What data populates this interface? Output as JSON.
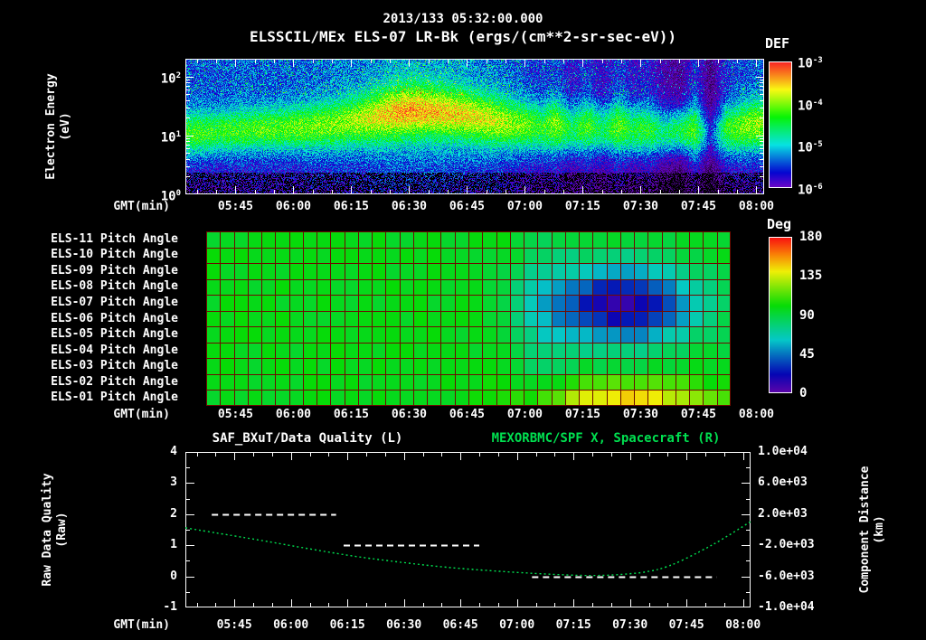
{
  "header": {
    "title": "2013/133 05:32:00.000",
    "subtitle": "ELSSCIL/MEx ELS-07 LR-Bk  (ergs/(cm**2-sr-sec-eV))"
  },
  "colors": {
    "background": "#000000",
    "text": "#ffffff",
    "accent_green": "#00e050",
    "grid_red": "#6e0a00"
  },
  "time_axis": {
    "label": "GMT(min)",
    "start": "05:32",
    "end": "08:02",
    "tick_labels": [
      "05:45",
      "06:00",
      "06:15",
      "06:30",
      "06:45",
      "07:00",
      "07:15",
      "07:30",
      "07:45",
      "08:00"
    ]
  },
  "chart_data": [
    {
      "type": "heatmap",
      "name": "electron-spectrogram",
      "title": "ELSSCIL/MEx ELS-07 LR-Bk",
      "units": "(ergs/(cm**2-sr-sec-eV))",
      "ylabel_lines": [
        "Electron Energy",
        "(eV)"
      ],
      "xlabel": "GMT(min)",
      "y_scale": "log10(eV)",
      "y_range_log10": [
        0,
        2.3
      ],
      "y_tick_exponents": [
        2,
        1,
        0
      ],
      "colorbar": {
        "label": "DEF",
        "tick_exponents": [
          -3,
          -4,
          -5,
          -6
        ],
        "range_log10_flux": [
          -6,
          -3
        ]
      },
      "columns_format": [
        "minutes_after_0532",
        "band_center_log10_eV",
        "band_width_log10_eV",
        "band_peak_log10_flux",
        "background_log10_flux"
      ],
      "columns": [
        [
          0,
          1.04,
          0.26,
          -4.25,
          -5.45
        ],
        [
          4,
          1.05,
          0.26,
          -4.25,
          -5.45
        ],
        [
          8,
          1.07,
          0.25,
          -4.3,
          -5.45
        ],
        [
          12,
          1.09,
          0.25,
          -4.25,
          -5.4
        ],
        [
          16,
          1.1,
          0.25,
          -4.2,
          -5.4
        ],
        [
          20,
          1.12,
          0.25,
          -4.2,
          -5.4
        ],
        [
          24,
          1.12,
          0.26,
          -4.15,
          -5.4
        ],
        [
          28,
          1.14,
          0.26,
          -4.1,
          -5.4
        ],
        [
          32,
          1.15,
          0.26,
          -4.1,
          -5.35
        ],
        [
          36,
          1.18,
          0.28,
          -4.05,
          -5.35
        ],
        [
          40,
          1.21,
          0.28,
          -4.0,
          -5.3
        ],
        [
          44,
          1.26,
          0.29,
          -3.9,
          -5.3
        ],
        [
          48,
          1.31,
          0.3,
          -3.75,
          -5.25
        ],
        [
          52,
          1.36,
          0.31,
          -3.55,
          -5.2
        ],
        [
          56,
          1.41,
          0.32,
          -3.4,
          -5.2
        ],
        [
          60,
          1.43,
          0.32,
          -3.45,
          -5.2
        ],
        [
          64,
          1.41,
          0.31,
          -3.5,
          -5.2
        ],
        [
          68,
          1.39,
          0.3,
          -3.55,
          -5.2
        ],
        [
          72,
          1.36,
          0.3,
          -3.6,
          -5.25
        ],
        [
          76,
          1.31,
          0.3,
          -3.7,
          -5.3
        ],
        [
          80,
          1.26,
          0.3,
          -3.8,
          -5.3
        ],
        [
          84,
          1.21,
          0.3,
          -3.95,
          -5.4
        ],
        [
          88,
          1.18,
          0.3,
          -4.1,
          -5.5
        ],
        [
          92,
          1.14,
          0.3,
          -4.35,
          -5.6
        ],
        [
          96,
          1.19,
          0.3,
          -4.0,
          -5.5
        ],
        [
          100,
          1.1,
          0.3,
          -4.55,
          -5.8
        ],
        [
          104,
          1.16,
          0.3,
          -4.2,
          -5.6
        ],
        [
          108,
          1.1,
          0.3,
          -4.6,
          -5.9
        ],
        [
          112,
          1.15,
          0.3,
          -4.15,
          -5.55
        ],
        [
          116,
          1.1,
          0.3,
          -4.45,
          -5.8
        ],
        [
          120,
          1.1,
          0.3,
          -4.35,
          -5.7
        ],
        [
          124,
          1.05,
          0.3,
          -4.7,
          -6.1
        ],
        [
          128,
          1.08,
          0.3,
          -4.5,
          -6.3
        ],
        [
          132,
          1.1,
          0.3,
          -4.2,
          -5.6
        ],
        [
          136,
          1.0,
          0.3,
          -5.6,
          -6.4
        ],
        [
          140,
          1.1,
          0.3,
          -4.35,
          -5.6
        ],
        [
          144,
          1.15,
          0.3,
          -4.1,
          -5.5
        ],
        [
          148,
          1.2,
          0.3,
          -3.95,
          -5.45
        ]
      ]
    },
    {
      "type": "heatmap",
      "name": "pitch-angle-grid",
      "row_labels": [
        "ELS-11 Pitch Angle",
        "ELS-10 Pitch Angle",
        "ELS-09 Pitch Angle",
        "ELS-08 Pitch Angle",
        "ELS-07 Pitch Angle",
        "ELS-06 Pitch Angle",
        "ELS-05 Pitch Angle",
        "ELS-04 Pitch Angle",
        "ELS-03 Pitch Angle",
        "ELS-02 Pitch Angle",
        "ELS-01 Pitch Angle"
      ],
      "xlabel": "GMT(min)",
      "colorbar": {
        "label": "Deg",
        "ticks": [
          180,
          135,
          90,
          45,
          0
        ],
        "range_deg": [
          0,
          180
        ]
      },
      "grid": {
        "cols": 38,
        "time_start_min": 5,
        "time_end_min": 141,
        "base_deg": 97,
        "cell_noise_deg": 4,
        "features": [
          {
            "name": "low-pitch-blob",
            "row_center": 4.1,
            "row_sigma": 1.8,
            "t_center_min": 113,
            "t_sigma_min": 14,
            "delta_deg": -85
          },
          {
            "name": "high-pitch-bottom-row",
            "row_center": 10,
            "row_sigma": 0.75,
            "t_center_min": 113,
            "t_sigma_min": 16,
            "delta_deg": 48
          },
          {
            "name": "cool-column-0700",
            "row_center": 5,
            "row_sigma": 6,
            "t_center_min": 93,
            "t_sigma_min": 5,
            "delta_deg": -14
          }
        ]
      }
    },
    {
      "type": "line",
      "name": "quality-distance",
      "title_left": "SAF_BXuT/Data Quality (L)",
      "title_right": "MEXORBMC/SPF X, Spacecraft (R)",
      "ylabel_left_lines": [
        "Raw Data Quality",
        "(Raw)"
      ],
      "ylabel_right_lines": [
        "Component Distance",
        "(km)"
      ],
      "xlabel": "GMT(min)",
      "y_left": {
        "range": [
          -1,
          4
        ],
        "ticks": [
          4,
          3,
          2,
          1,
          0,
          -1
        ]
      },
      "y_right": {
        "range": [
          -10000,
          10000
        ],
        "ticks": [
          "1.0e+04",
          "6.0e+03",
          "2.0e+03",
          "-2.0e+03",
          "-6.0e+03",
          "-1.0e+04"
        ]
      },
      "quality_segments": [
        {
          "value": 2,
          "from_min": 7,
          "to_min": 40
        },
        {
          "value": 1,
          "from_min": 42,
          "to_min": 78
        },
        {
          "value": 0,
          "from_min": 92,
          "to_min": 141
        }
      ],
      "distance_series_min_km": [
        [
          0,
          240
        ],
        [
          10,
          -560
        ],
        [
          22,
          -1520
        ],
        [
          34,
          -2560
        ],
        [
          46,
          -3520
        ],
        [
          58,
          -4240
        ],
        [
          69,
          -4840
        ],
        [
          81,
          -5280
        ],
        [
          93,
          -5640
        ],
        [
          104,
          -5880
        ],
        [
          110,
          -5900
        ],
        [
          116,
          -5760
        ],
        [
          122,
          -5480
        ],
        [
          128,
          -4840
        ],
        [
          137,
          -2720
        ],
        [
          143,
          -1100
        ],
        [
          150,
          1040
        ]
      ]
    }
  ]
}
